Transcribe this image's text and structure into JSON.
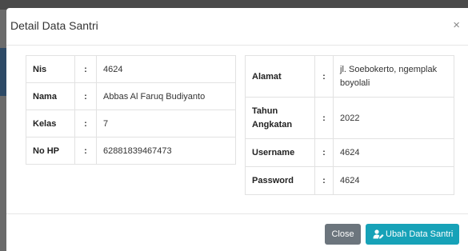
{
  "modal": {
    "title": "Detail Data Santri",
    "close_glyph": "×"
  },
  "left_table": {
    "rows": [
      {
        "label": "Nis",
        "sep": ":",
        "value": "4624"
      },
      {
        "label": "Nama",
        "sep": ":",
        "value": "Abbas Al Faruq Budiyanto"
      },
      {
        "label": "Kelas",
        "sep": ":",
        "value": "7"
      },
      {
        "label": "No HP",
        "sep": ":",
        "value": "62881839467473"
      }
    ]
  },
  "right_table": {
    "rows": [
      {
        "label": "Alamat",
        "sep": ":",
        "value": "jl. Soebokerto, ngemplak boyolali"
      },
      {
        "label": "Tahun Angkatan",
        "sep": ":",
        "value": "2022"
      },
      {
        "label": "Username",
        "sep": ":",
        "value": "4624"
      },
      {
        "label": "Password",
        "sep": ":",
        "value": "4624"
      }
    ]
  },
  "footer": {
    "close_label": "Close",
    "edit_label": "Ubah Data Santri",
    "edit_icon": "user-edit-icon"
  },
  "colors": {
    "close_button": "#6c757d",
    "edit_button": "#17a2b8"
  }
}
